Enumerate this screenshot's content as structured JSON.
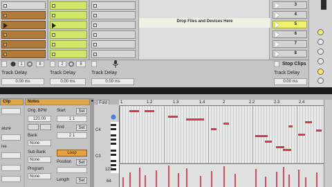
{
  "session": {
    "track1": {
      "delay_label": "Track Delay",
      "delay_value": "0.00 ms",
      "num": "1",
      "slot_value": "8"
    },
    "track2": {
      "delay_label": "Track Delay",
      "delay_value": "0.00 ms",
      "num": "2",
      "slot_value": "8"
    },
    "track3": {
      "delay_label": "Track Delay",
      "delay_value": "0.00 ms"
    },
    "drop_text": "Drop Files and Devices Here",
    "master": {
      "stop_clips_label": "Stop Clips",
      "delay_label": "Track Delay",
      "delay_value": "0.00 ms"
    },
    "scenes": [
      "3",
      "4",
      "5",
      "6",
      "7",
      "8"
    ],
    "selected_scene": "5"
  },
  "clip_panel": {
    "header": "Clip",
    "labels": [
      "ature",
      "ive"
    ]
  },
  "notes_panel": {
    "header": "Notes",
    "orig_bpm_label": "Orig. BPM",
    "orig_bpm_value": "120.00",
    "bank_label": "Bank",
    "bank_value": "None",
    "sub_bank_label": "Sub Bank",
    "sub_bank_value": "None",
    "program_label": "Program",
    "program_value": "None",
    "start_label": "Start",
    "end_label": "End",
    "loop_label": "Loop",
    "position_label": "Position",
    "length_label": "Length",
    "set_label": "Set",
    "start_val": "1 1",
    "end_val": "2 1"
  },
  "editor": {
    "fold_label": "Fold",
    "ruler": [
      "1",
      "1.2",
      "1.3",
      "1.4",
      "2",
      "2.2",
      "2.3",
      "2.4"
    ],
    "note_labels": [
      "C4",
      "C3"
    ],
    "velocity_labels": [
      "127",
      "64"
    ]
  },
  "colors": {
    "clip_orange": "#b07a3a",
    "clip_green": "#cfe86a",
    "scene_selected": "#f2f26a",
    "note_red": "#d8384a",
    "loop_orange": "#e8a13f"
  }
}
